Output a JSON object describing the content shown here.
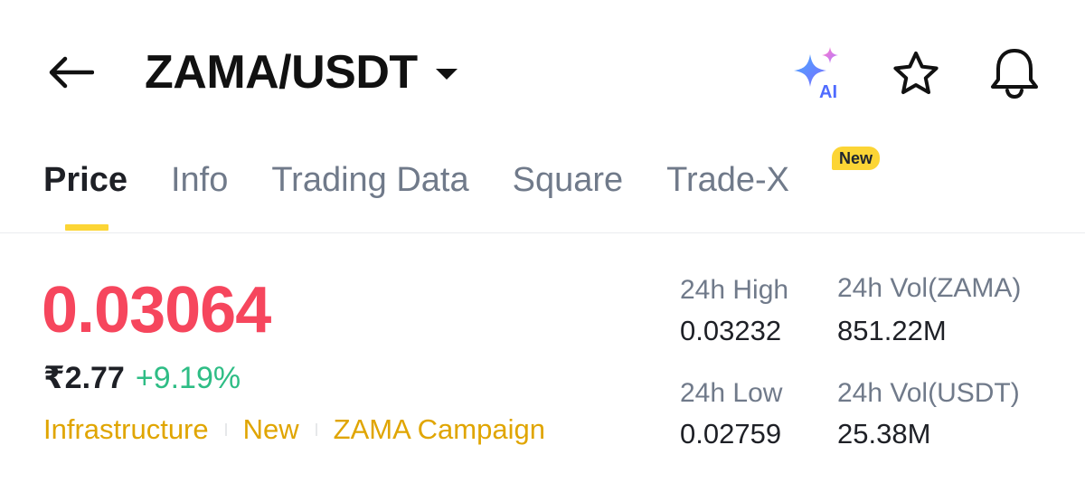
{
  "header": {
    "pair": "ZAMA/USDT",
    "ai_label": "AI",
    "icons": [
      "back-arrow-icon",
      "caret-down-icon",
      "ai-sparkle-icon",
      "star-icon",
      "bell-icon"
    ]
  },
  "tabs": [
    {
      "label": "Price",
      "active": true
    },
    {
      "label": "Info",
      "active": false
    },
    {
      "label": "Trading Data",
      "active": false
    },
    {
      "label": "Square",
      "active": false
    },
    {
      "label": "Trade-X",
      "active": false,
      "badge": "New"
    }
  ],
  "price": {
    "last": "0.03064",
    "fiat": "₹2.77",
    "change": "+9.19%"
  },
  "tags": [
    "Infrastructure",
    "New",
    "ZAMA Campaign"
  ],
  "stats": {
    "high_label": "24h High",
    "high_value": "0.03232",
    "low_label": "24h Low",
    "low_value": "0.02759",
    "vol_base_label": "24h Vol(ZAMA)",
    "vol_base_value": "851.22M",
    "vol_quote_label": "24h Vol(USDT)",
    "vol_quote_value": "25.38M"
  },
  "colors": {
    "price_down_red": "#f6465d",
    "change_green": "#2ebd85",
    "accent_yellow": "#fcd535",
    "tag_gold": "#e0a500",
    "muted_text": "#707a8a"
  }
}
